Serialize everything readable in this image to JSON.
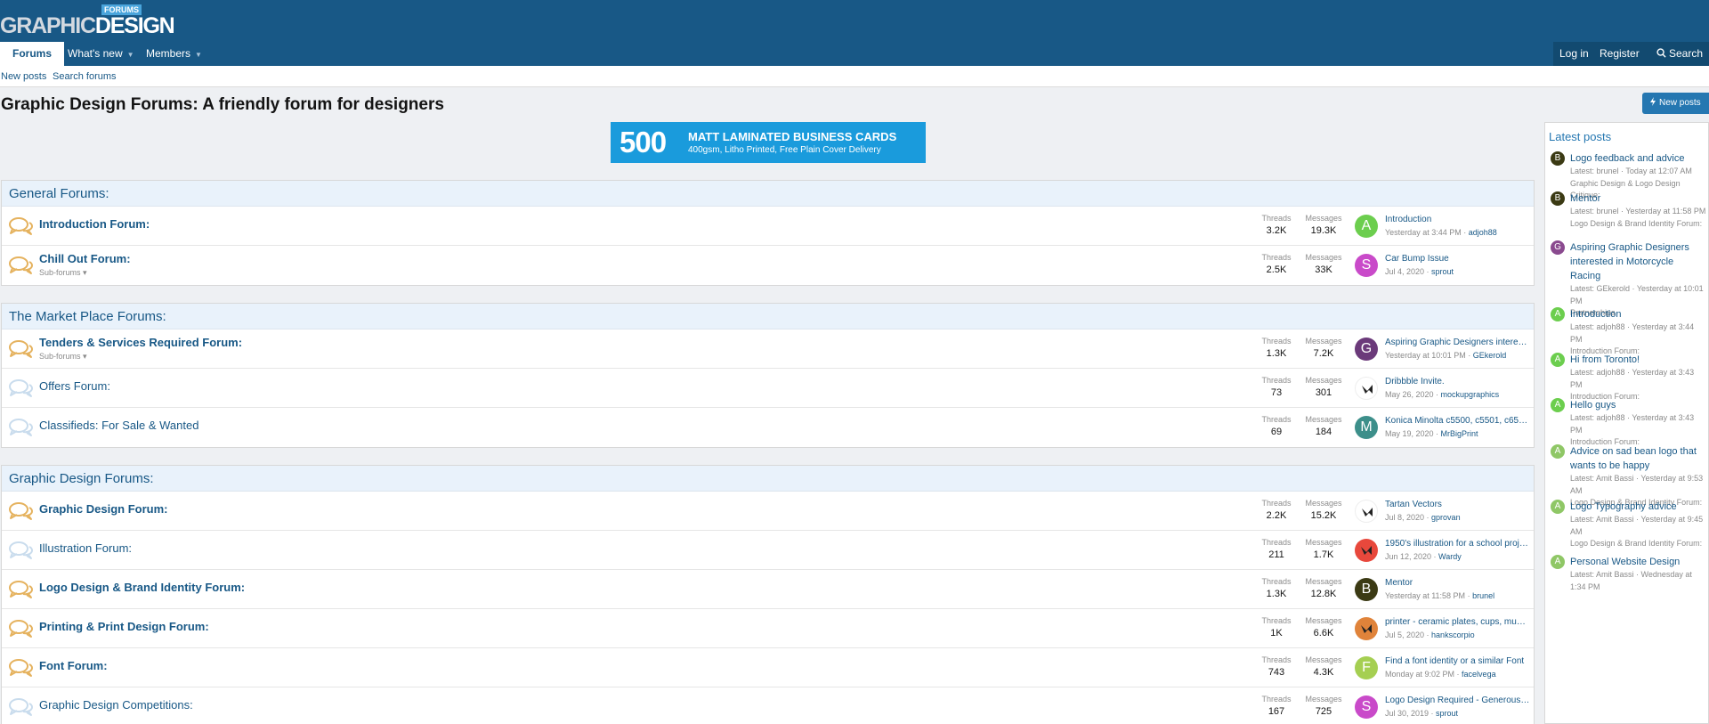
{
  "site": {
    "logo_part1": "GRAPHIC",
    "logo_part2": "DESIGN",
    "logo_badge": "FORUMS"
  },
  "nav": {
    "tabs": [
      {
        "label": "Forums"
      },
      {
        "label": "What's new"
      },
      {
        "label": "Members"
      }
    ],
    "login": "Log in",
    "register": "Register",
    "search": "Search"
  },
  "subnav": [
    "New posts",
    "Search forums"
  ],
  "page_title": "Graphic Design Forums: A friendly forum for designers",
  "new_posts_button": "New posts",
  "ad": {
    "number": "500",
    "line1": "MATT LAMINATED BUSINESS CARDS",
    "line2": "400gsm, Litho Printed, Free Plain Cover Delivery"
  },
  "stat_labels": {
    "threads": "Threads",
    "messages": "Messages"
  },
  "categories": [
    {
      "title": "General Forums:",
      "nodes": [
        {
          "title": "Introduction Forum:",
          "bold": true,
          "sub": "",
          "threads": "3.2K",
          "messages": "19.3K",
          "avatar": "A",
          "avatar_color": "#6cce4e",
          "latest_title": "Introduction",
          "latest_date": "Yesterday at 3:44 PM",
          "latest_user": "adjoh88"
        },
        {
          "title": "Chill Out Forum:",
          "bold": true,
          "sub": "Sub-forums ▾",
          "threads": "2.5K",
          "messages": "33K",
          "avatar": "S",
          "avatar_color": "#c94ac9",
          "latest_title": "Car Bump Issue",
          "latest_date": "Jul 4, 2020",
          "latest_user": "sprout"
        }
      ]
    },
    {
      "title": "The Market Place Forums:",
      "nodes": [
        {
          "title": "Tenders & Services Required Forum:",
          "bold": true,
          "sub": "Sub-forums ▾",
          "threads": "1.3K",
          "messages": "7.2K",
          "avatar": "G",
          "avatar_color": "#6b3a7a",
          "latest_title": "Aspiring Graphic Designers intere…",
          "latest_date": "Yesterday at 10:01 PM",
          "latest_user": "GEkerold"
        },
        {
          "title": "Offers Forum:",
          "bold": false,
          "sub": "",
          "threads": "73",
          "messages": "301",
          "avatar": "",
          "avatar_color": "#ffffff",
          "latest_title": "Dribbble Invite.",
          "latest_date": "May 26, 2020",
          "latest_user": "mockupgraphics"
        },
        {
          "title": "Classifieds: For Sale & Wanted",
          "bold": false,
          "sub": "",
          "threads": "69",
          "messages": "184",
          "avatar": "M",
          "avatar_color": "#3d8f8a",
          "latest_title": "Konica Minolta c5500, c5501, c65…",
          "latest_date": "May 19, 2020",
          "latest_user": "MrBigPrint"
        }
      ]
    },
    {
      "title": "Graphic Design Forums:",
      "nodes": [
        {
          "title": "Graphic Design Forum:",
          "bold": true,
          "sub": "",
          "threads": "2.2K",
          "messages": "15.2K",
          "avatar": "",
          "avatar_color": "#ffffff",
          "latest_title": "Tartan Vectors",
          "latest_date": "Jul 8, 2020",
          "latest_user": "gprovan"
        },
        {
          "title": "Illustration Forum:",
          "bold": false,
          "sub": "",
          "threads": "211",
          "messages": "1.7K",
          "avatar": "",
          "avatar_color": "#e8483c",
          "latest_title": "1950's illustration for a school proj…",
          "latest_date": "Jun 12, 2020",
          "latest_user": "Wardy"
        },
        {
          "title": "Logo Design & Brand Identity Forum:",
          "bold": true,
          "sub": "",
          "threads": "1.3K",
          "messages": "12.8K",
          "avatar": "B",
          "avatar_color": "#3b3a14",
          "latest_title": "Mentor",
          "latest_date": "Yesterday at 11:58 PM",
          "latest_user": "brunel"
        },
        {
          "title": "Printing & Print Design Forum:",
          "bold": true,
          "sub": "",
          "threads": "1K",
          "messages": "6.6K",
          "avatar": "",
          "avatar_color": "#e0833a",
          "latest_title": "printer - ceramic plates, cups, mu…",
          "latest_date": "Jul 5, 2020",
          "latest_user": "hankscorpio"
        },
        {
          "title": "Font Forum:",
          "bold": true,
          "sub": "",
          "threads": "743",
          "messages": "4.3K",
          "avatar": "F",
          "avatar_color": "#a5cf52",
          "latest_title": "Find a font identity or a similar Font",
          "latest_date": "Monday at 9:02 PM",
          "latest_user": "facelvega"
        },
        {
          "title": "Graphic Design Competitions:",
          "bold": false,
          "sub": "",
          "threads": "167",
          "messages": "725",
          "avatar": "S",
          "avatar_color": "#c94ac9",
          "latest_title": "Logo Design Required - Generous…",
          "latest_date": "Jul 30, 2019",
          "latest_user": "sprout"
        }
      ]
    }
  ],
  "sidebar": {
    "title": "Latest posts",
    "items": [
      {
        "avatar": "B",
        "avatar_color": "#3b3a14",
        "title": "Logo feedback and advice",
        "meta": "Latest: brunel · Today at 12:07 AM",
        "forum": "Graphic Design & Logo Design Critique:"
      },
      {
        "avatar": "B",
        "avatar_color": "#3b3a14",
        "title": "Mentor",
        "meta": "Latest: brunel · Yesterday at 11:58 PM",
        "forum": "Logo Design & Brand Identity Forum:"
      },
      {
        "avatar": "G",
        "avatar_color": "#8a4a8f",
        "title": "Aspiring Graphic Designers interested in Motorcycle Racing",
        "meta": "Latest: GEkerold · Yesterday at 10:01 PM",
        "forum": "Partnerships"
      },
      {
        "avatar": "A",
        "avatar_color": "#6cce4e",
        "title": "Introduction",
        "meta": "Latest: adjoh88 · Yesterday at 3:44 PM",
        "forum": "Introduction Forum:"
      },
      {
        "avatar": "A",
        "avatar_color": "#6cce4e",
        "title": "Hi from Toronto!",
        "meta": "Latest: adjoh88 · Yesterday at 3:43 PM",
        "forum": "Introduction Forum:"
      },
      {
        "avatar": "A",
        "avatar_color": "#6cce4e",
        "title": "Hello guys",
        "meta": "Latest: adjoh88 · Yesterday at 3:43 PM",
        "forum": "Introduction Forum:"
      },
      {
        "avatar": "A",
        "avatar_color": "#8fc766",
        "title": "Advice on sad bean logo that wants to be happy",
        "meta": "Latest: Amit Bassi · Yesterday at 9:53 AM",
        "forum": "Logo Design & Brand Identity Forum:"
      },
      {
        "avatar": "A",
        "avatar_color": "#8fc766",
        "title": "Logo Typography advice",
        "meta": "Latest: Amit Bassi · Yesterday at 9:45 AM",
        "forum": "Logo Design & Brand Identity Forum:"
      },
      {
        "avatar": "A",
        "avatar_color": "#8fc766",
        "title": "Personal Website Design",
        "meta": "Latest: Amit Bassi · Wednesday at 1:34 PM",
        "forum": ""
      }
    ]
  },
  "colors": {
    "header": "#185886",
    "link": "#185886",
    "accent": "#2577b1",
    "block_header_bg": "#e9f2fb",
    "ad_bg": "#1a9bdc"
  }
}
